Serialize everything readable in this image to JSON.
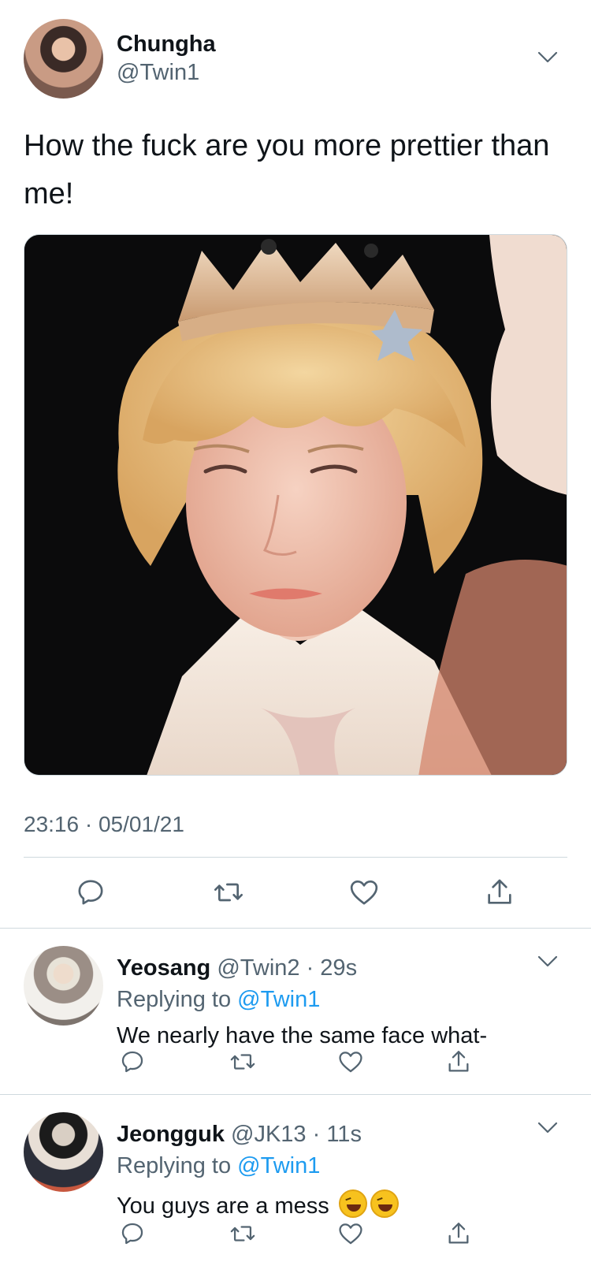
{
  "main_tweet": {
    "author_name": "Chungha",
    "author_handle": "@Twin1",
    "text": "How the fuck are you more prettier than me!",
    "timestamp": "23:16 · 05/01/21",
    "avatar_icon": "profile-photo",
    "actions": [
      "reply-icon",
      "retweet-icon",
      "like-icon",
      "share-icon"
    ]
  },
  "replies": [
    {
      "name": "Yeosang",
      "handle_time": " @Twin2 · 29s",
      "replying_prefix": "Replying to ",
      "replying_mention": "@Twin1",
      "text": "We nearly have the same face what-",
      "emoji": ""
    },
    {
      "name": "Jeongguk",
      "handle_time": " @JK13 · 11s",
      "replying_prefix": "Replying to ",
      "replying_mention": "@Twin1",
      "text": "You guys are a mess ",
      "emoji": "🤣🤣"
    }
  ],
  "colors": {
    "text_primary": "#0f1419",
    "text_secondary": "#536471",
    "link": "#1d9bf0",
    "divider": "#cfd9de",
    "icon": "#536471"
  }
}
